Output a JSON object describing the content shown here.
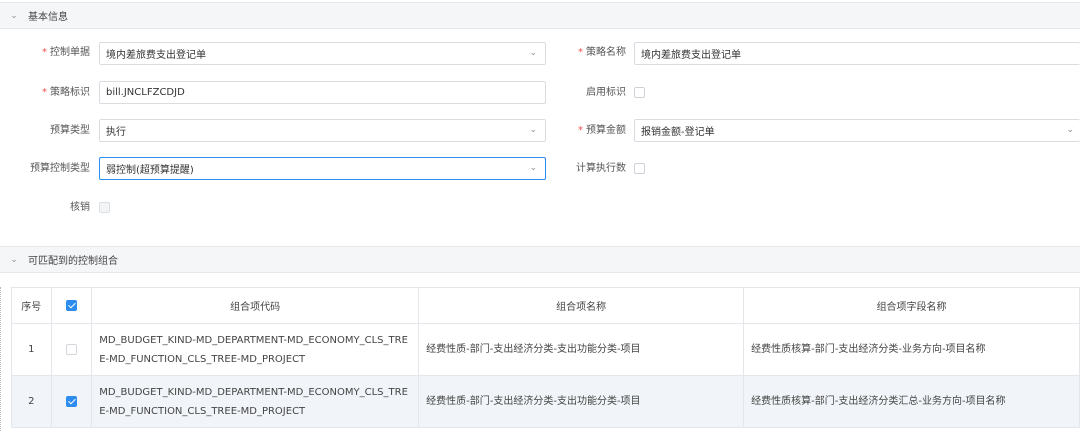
{
  "sections": {
    "basic": {
      "title": "基本信息"
    },
    "combos": {
      "title": "可匹配到的控制组合"
    }
  },
  "form": {
    "control_doc": {
      "label": "控制单据",
      "value": "境内差旅费支出登记单"
    },
    "strategy_name": {
      "label": "策略名称",
      "value": "境内差旅费支出登记单"
    },
    "strategy_id": {
      "label": "策略标识",
      "value": "bill.JNCLFZCDJD"
    },
    "enabled_flag": {
      "label": "启用标识",
      "checked": false
    },
    "budget_type": {
      "label": "预算类型",
      "value": "执行"
    },
    "budget_amount": {
      "label": "预算金额",
      "value": "报销金额-登记单"
    },
    "budget_control_type": {
      "label": "预算控制类型",
      "value": "弱控制(超预算提醒)"
    },
    "calc_exec": {
      "label": "计算执行数",
      "checked": false
    },
    "writeoff": {
      "label": "核销",
      "checked": false
    },
    "required_mark": "*"
  },
  "table": {
    "headers": {
      "index": "序号",
      "code": "组合项代码",
      "name": "组合项名称",
      "field_name": "组合项字段名称"
    },
    "header_checked": true,
    "rows": [
      {
        "index": "1",
        "checked": false,
        "code": "MD_BUDGET_KIND-MD_DEPARTMENT-MD_ECONOMY_CLS_TREE-MD_FUNCTION_CLS_TREE-MD_PROJECT",
        "name": "经费性质-部门-支出经济分类-支出功能分类-项目",
        "field_name": "经费性质核算-部门-支出经济分类-业务方向-项目名称"
      },
      {
        "index": "2",
        "checked": true,
        "code": "MD_BUDGET_KIND-MD_DEPARTMENT-MD_ECONOMY_CLS_TREE-MD_FUNCTION_CLS_TREE-MD_PROJECT",
        "name": "经费性质-部门-支出经济分类-支出功能分类-项目",
        "field_name": "经费性质核算-部门-支出经济分类汇总-业务方向-项目名称"
      }
    ]
  },
  "icons": {
    "collapse": "chevron-down-icon",
    "dropdown": "chevron-down-icon"
  },
  "colors": {
    "accent": "#2d8cf0",
    "required": "#f05050",
    "header_bg": "#f5f6f8",
    "selected_row": "#f1f4f8"
  }
}
